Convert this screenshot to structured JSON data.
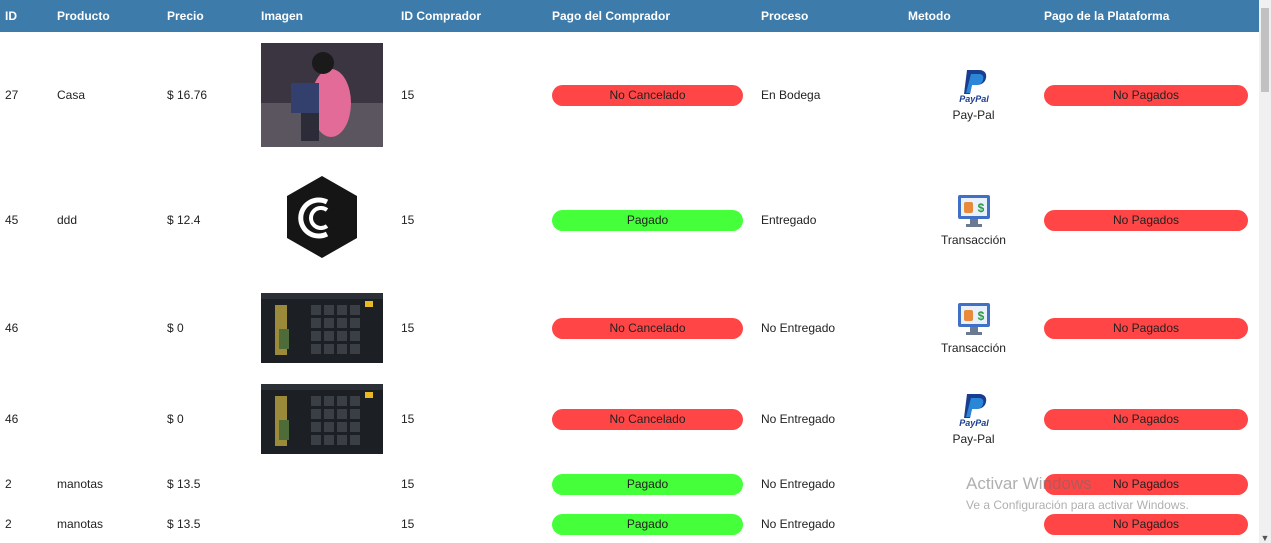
{
  "columns": [
    "ID",
    "Producto",
    "Precio",
    "Imagen",
    "ID Comprador",
    "Pago del Comprador",
    "Proceso",
    "Metodo",
    "Pago de la Plataforma"
  ],
  "rows": [
    {
      "id": "27",
      "producto": "Casa",
      "precio": "$ 16.76",
      "imagen": "photo",
      "id_comprador": "15",
      "pago_comprador": "No Cancelado",
      "pago_status": "red",
      "proceso": "En Bodega",
      "metodo": "Pay-Pal",
      "metodo_icon": "paypal-icon",
      "pago_plataforma": "No Pagados"
    },
    {
      "id": "45",
      "producto": "ddd",
      "precio": "$ 12.4",
      "imagen": "logo",
      "id_comprador": "15",
      "pago_comprador": "Pagado",
      "pago_status": "green",
      "proceso": "Entregado",
      "metodo": "Transacción",
      "metodo_icon": "transfer-icon",
      "pago_plataforma": "No Pagados"
    },
    {
      "id": "46",
      "producto": "",
      "precio": "$ 0",
      "imagen": "game",
      "id_comprador": "15",
      "pago_comprador": "No Cancelado",
      "pago_status": "red",
      "proceso": "No Entregado",
      "metodo": "Transacción",
      "metodo_icon": "transfer-icon",
      "pago_plataforma": "No Pagados"
    },
    {
      "id": "46",
      "producto": "",
      "precio": "$ 0",
      "imagen": "game",
      "id_comprador": "15",
      "pago_comprador": "No Cancelado",
      "pago_status": "red",
      "proceso": "No Entregado",
      "metodo": "Pay-Pal",
      "metodo_icon": "paypal-icon",
      "pago_plataforma": "No Pagados"
    },
    {
      "id": "2",
      "producto": "manotas",
      "precio": "$ 13.5",
      "imagen": "none",
      "id_comprador": "15",
      "pago_comprador": "Pagado",
      "pago_status": "green",
      "proceso": "No Entregado",
      "metodo": "",
      "metodo_icon": "",
      "pago_plataforma": "No Pagados"
    },
    {
      "id": "2",
      "producto": "manotas",
      "precio": "$ 13.5",
      "imagen": "none",
      "id_comprador": "15",
      "pago_comprador": "Pagado",
      "pago_status": "green",
      "proceso": "No Entregado",
      "metodo": "",
      "metodo_icon": "",
      "pago_plataforma": "No Pagados"
    }
  ],
  "paypal_logo_text": "PayPal",
  "colors": {
    "header": "#3d7bab",
    "red_pill": "#ff4545",
    "green_pill": "#45ff3a"
  },
  "watermark": {
    "line1": "Activar Windows",
    "line2": "Ve a Configuración para activar Windows."
  }
}
